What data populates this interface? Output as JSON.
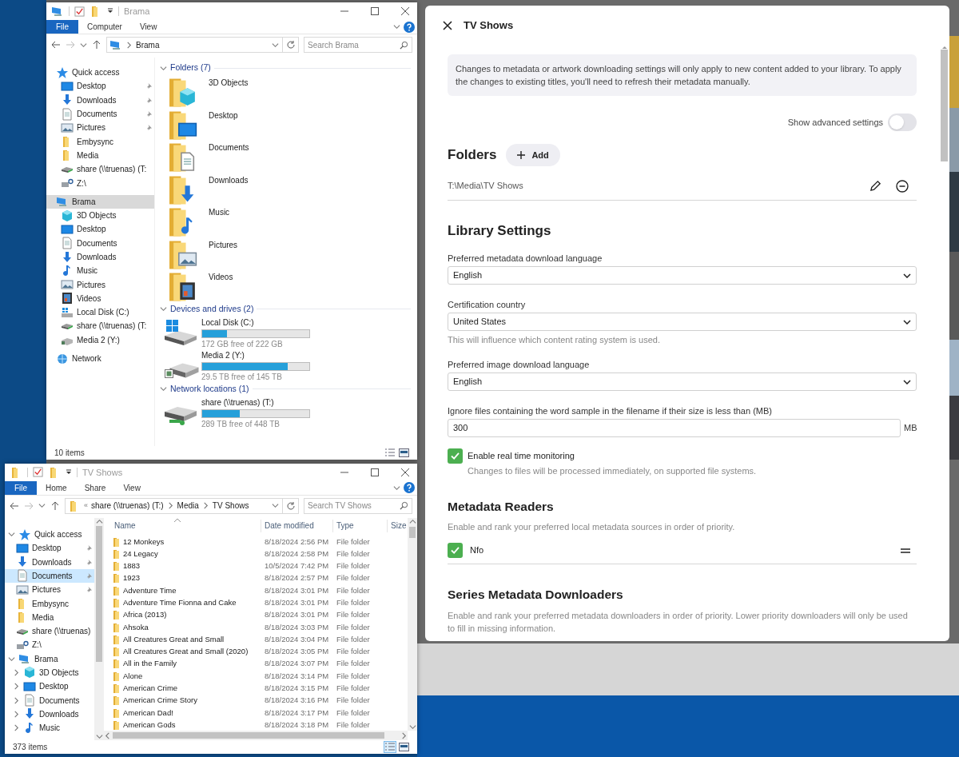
{
  "windows": [
    {
      "title": "Brama",
      "ribbon_tabs": [
        {
          "label": "File",
          "kind": "file"
        },
        {
          "label": "Computer",
          "kind": "tab"
        },
        {
          "label": "View",
          "kind": "tab"
        }
      ],
      "address": {
        "kind": "computer",
        "crumbs": [
          "Brama"
        ]
      },
      "search": {
        "placeholder": "Search Brama"
      },
      "nav": [
        {
          "label": "Quick access",
          "kind": "star",
          "pinned": false,
          "selected": false,
          "children": [
            {
              "label": "Desktop",
              "kind": "desktop",
              "pinned": true,
              "selected": false
            },
            {
              "label": "Downloads",
              "kind": "downloads",
              "pinned": true,
              "selected": false
            },
            {
              "label": "Documents",
              "kind": "documents",
              "pinned": true,
              "selected": false
            },
            {
              "label": "Pictures",
              "kind": "pictures",
              "pinned": true,
              "selected": false
            },
            {
              "label": "Embysync",
              "kind": "folder",
              "pinned": false,
              "selected": false
            },
            {
              "label": "Media",
              "kind": "folder",
              "pinned": false,
              "selected": false
            },
            {
              "label": "share (\\\\truenas) (T:",
              "kind": "netdrive",
              "pinned": false,
              "selected": false
            },
            {
              "label": "Z:\\",
              "kind": "unknown",
              "pinned": false,
              "selected": false
            }
          ]
        },
        {
          "label": "Brama",
          "kind": "computer",
          "pinned": false,
          "selected": true,
          "children": [
            {
              "label": "3D Objects",
              "kind": "cube",
              "pinned": false,
              "selected": false
            },
            {
              "label": "Desktop",
              "kind": "desktop",
              "pinned": false,
              "selected": false
            },
            {
              "label": "Documents",
              "kind": "documents",
              "pinned": false,
              "selected": false
            },
            {
              "label": "Downloads",
              "kind": "downloads",
              "pinned": false,
              "selected": false
            },
            {
              "label": "Music",
              "kind": "music",
              "pinned": false,
              "selected": false
            },
            {
              "label": "Pictures",
              "kind": "pictures",
              "pinned": false,
              "selected": false
            },
            {
              "label": "Videos",
              "kind": "videos",
              "pinned": false,
              "selected": false
            },
            {
              "label": "Local Disk (C:)",
              "kind": "disk",
              "pinned": false,
              "selected": false
            },
            {
              "label": "share (\\\\truenas) (T:",
              "kind": "netdrive",
              "pinned": false,
              "selected": false
            },
            {
              "label": "Media 2 (Y:)",
              "kind": "drive",
              "pinned": false,
              "selected": false
            }
          ]
        },
        {
          "label": "Network",
          "kind": "network",
          "pinned": false,
          "selected": false
        }
      ],
      "groups": [
        {
          "title": "Folders (7)",
          "kind": "folders",
          "items": [
            {
              "name": "3D Objects",
              "kind": "cube"
            },
            {
              "name": "Desktop",
              "kind": "desktop"
            },
            {
              "name": "Documents",
              "kind": "documents"
            },
            {
              "name": "Downloads",
              "kind": "downloads"
            },
            {
              "name": "Music",
              "kind": "music"
            },
            {
              "name": "Pictures",
              "kind": "pictures"
            },
            {
              "name": "Videos",
              "kind": "videos"
            }
          ]
        },
        {
          "title": "Devices and drives (2)",
          "kind": "drives",
          "items": [
            {
              "name": "Local Disk (C:)",
              "kind": "disk",
              "level": 0.23,
              "free": "172 GB free of 222 GB"
            },
            {
              "name": "Media 2 (Y:)",
              "kind": "drive",
              "level": 0.8,
              "free": "29.5 TB free of 145 TB"
            }
          ]
        },
        {
          "title": "Network locations (1)",
          "kind": "drives",
          "items": [
            {
              "name": "share (\\\\truenas) (T:)",
              "kind": "netdrive",
              "level": 0.35,
              "free": "289 TB free of 448 TB"
            }
          ]
        }
      ],
      "status": "10 items"
    },
    {
      "title": "TV Shows",
      "ribbon_tabs": [
        {
          "label": "File",
          "kind": "file"
        },
        {
          "label": "Home",
          "kind": "tab"
        },
        {
          "label": "Share",
          "kind": "tab"
        },
        {
          "label": "View",
          "kind": "tab"
        }
      ],
      "address": {
        "kind": "folder",
        "overflow": "«",
        "crumbs": [
          "share (\\\\truenas) (T:)",
          "Media",
          "TV Shows"
        ]
      },
      "search": {
        "placeholder": "Search TV Shows"
      },
      "nav": [
        {
          "label": "Quick access",
          "kind": "star",
          "expanded": true,
          "pinned": false,
          "selected": false,
          "children": [
            {
              "label": "Desktop",
              "kind": "desktop",
              "pinned": true,
              "selected": false
            },
            {
              "label": "Downloads",
              "kind": "downloads",
              "pinned": true,
              "selected": false
            },
            {
              "label": "Documents",
              "kind": "documents",
              "pinned": true,
              "selected": true
            },
            {
              "label": "Pictures",
              "kind": "pictures",
              "pinned": true,
              "selected": false
            },
            {
              "label": "Embysync",
              "kind": "folder",
              "pinned": false,
              "selected": false
            },
            {
              "label": "Media",
              "kind": "folder",
              "pinned": false,
              "selected": false
            },
            {
              "label": "share (\\\\truenas)",
              "kind": "netdrive",
              "pinned": false,
              "selected": false
            },
            {
              "label": "Z:\\",
              "kind": "unknown",
              "pinned": false,
              "selected": false
            }
          ]
        },
        {
          "label": "Brama",
          "kind": "computer",
          "expanded": true,
          "pinned": false,
          "selected": false,
          "children": [
            {
              "label": "3D Objects",
              "kind": "cube",
              "expanded": false,
              "pinned": false,
              "selected": false
            },
            {
              "label": "Desktop",
              "kind": "desktop",
              "expanded": false,
              "pinned": false,
              "selected": false
            },
            {
              "label": "Documents",
              "kind": "documents",
              "expanded": false,
              "pinned": false,
              "selected": false
            },
            {
              "label": "Downloads",
              "kind": "downloads",
              "expanded": false,
              "pinned": false,
              "selected": false
            },
            {
              "label": "Music",
              "kind": "music",
              "expanded": false,
              "pinned": false,
              "selected": false
            }
          ]
        }
      ],
      "table": {
        "columns": [
          "Name",
          "Date modified",
          "Type",
          "Size"
        ],
        "rows": [
          {
            "name": "12 Monkeys",
            "date": "8/18/2024 2:56 PM",
            "type": "File folder"
          },
          {
            "name": "24 Legacy",
            "date": "8/18/2024 2:58 PM",
            "type": "File folder"
          },
          {
            "name": "1883",
            "date": "10/5/2024 7:42 PM",
            "type": "File folder"
          },
          {
            "name": "1923",
            "date": "8/18/2024 2:57 PM",
            "type": "File folder"
          },
          {
            "name": "Adventure Time",
            "date": "8/18/2024 3:01 PM",
            "type": "File folder"
          },
          {
            "name": "Adventure Time Fionna and Cake",
            "date": "8/18/2024 3:01 PM",
            "type": "File folder"
          },
          {
            "name": "Africa (2013)",
            "date": "8/18/2024 3:01 PM",
            "type": "File folder"
          },
          {
            "name": "Ahsoka",
            "date": "8/18/2024 3:03 PM",
            "type": "File folder"
          },
          {
            "name": "All Creatures Great and Small",
            "date": "8/18/2024 3:04 PM",
            "type": "File folder"
          },
          {
            "name": "All Creatures Great and Small (2020)",
            "date": "8/18/2024 3:05 PM",
            "type": "File folder"
          },
          {
            "name": "All in the Family",
            "date": "8/18/2024 3:07 PM",
            "type": "File folder"
          },
          {
            "name": "Alone",
            "date": "8/18/2024 3:14 PM",
            "type": "File folder"
          },
          {
            "name": "American Crime",
            "date": "8/18/2024 3:15 PM",
            "type": "File folder"
          },
          {
            "name": "American Crime Story",
            "date": "8/18/2024 3:16 PM",
            "type": "File folder"
          },
          {
            "name": "American Dad!",
            "date": "8/18/2024 3:17 PM",
            "type": "File folder"
          },
          {
            "name": "American Gods",
            "date": "8/18/2024 3:18 PM",
            "type": "File folder"
          }
        ]
      },
      "status": "373 items"
    }
  ],
  "dialog": {
    "title": "TV Shows",
    "notice": "Changes to metadata or artwork downloading settings will only apply to new content added to your library. To apply the changes to existing titles, you'll need to refresh their metadata manually.",
    "advanced_toggle": {
      "label": "Show advanced settings",
      "on": false
    },
    "folders": {
      "heading": "Folders",
      "add_label": "Add",
      "paths": [
        "T:\\Media\\TV Shows"
      ]
    },
    "library_settings": {
      "heading": "Library Settings",
      "fields": [
        {
          "kind": "select",
          "label": "Preferred metadata download language",
          "value": "English"
        },
        {
          "kind": "select",
          "label": "Certification country",
          "value": "United States",
          "help": "This will influence which content rating system is used."
        },
        {
          "kind": "select",
          "label": "Preferred image download language",
          "value": "English"
        },
        {
          "kind": "number",
          "label": "Ignore files containing the word sample in the filename if their size is less than (MB)",
          "value": "300",
          "unit": "MB"
        },
        {
          "kind": "checkbox",
          "label": "Enable real time monitoring",
          "checked": true,
          "help": "Changes to files will be processed immediately, on supported file systems."
        }
      ]
    },
    "metadata_readers": {
      "heading": "Metadata Readers",
      "description": "Enable and rank your preferred local metadata sources in order of priority.",
      "items": [
        {
          "label": "Nfo",
          "checked": true
        }
      ]
    },
    "series_downloaders": {
      "heading": "Series Metadata Downloaders",
      "description": "Enable and rank your preferred metadata downloaders in order of priority. Lower priority downloaders will only be used to fill in missing information."
    }
  }
}
